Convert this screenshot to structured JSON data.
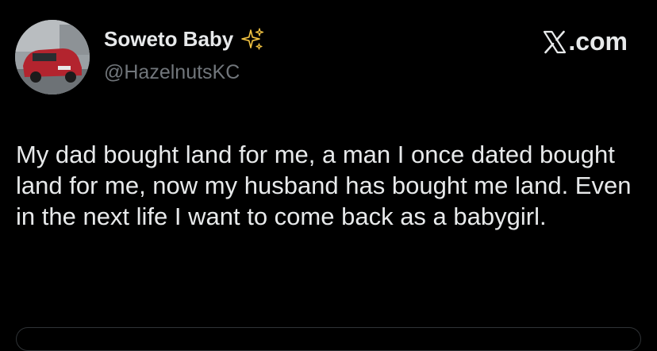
{
  "author": {
    "display_name": "Soweto Baby",
    "handle": "@HazelnutsKC",
    "emoji_icon": "sparkles-icon"
  },
  "brand": {
    "label": ".com",
    "logo_icon": "x-logo-icon"
  },
  "tweet": {
    "text": "My dad bought land for me, a man I once dated bought land for me, now my husband has bought me land. Even in the next life I want to come back as a babygirl."
  },
  "colors": {
    "background": "#000000",
    "text_primary": "#e7e9ea",
    "text_secondary": "#71767b",
    "sparkle": "#f5c542",
    "divider": "#2f3336"
  }
}
